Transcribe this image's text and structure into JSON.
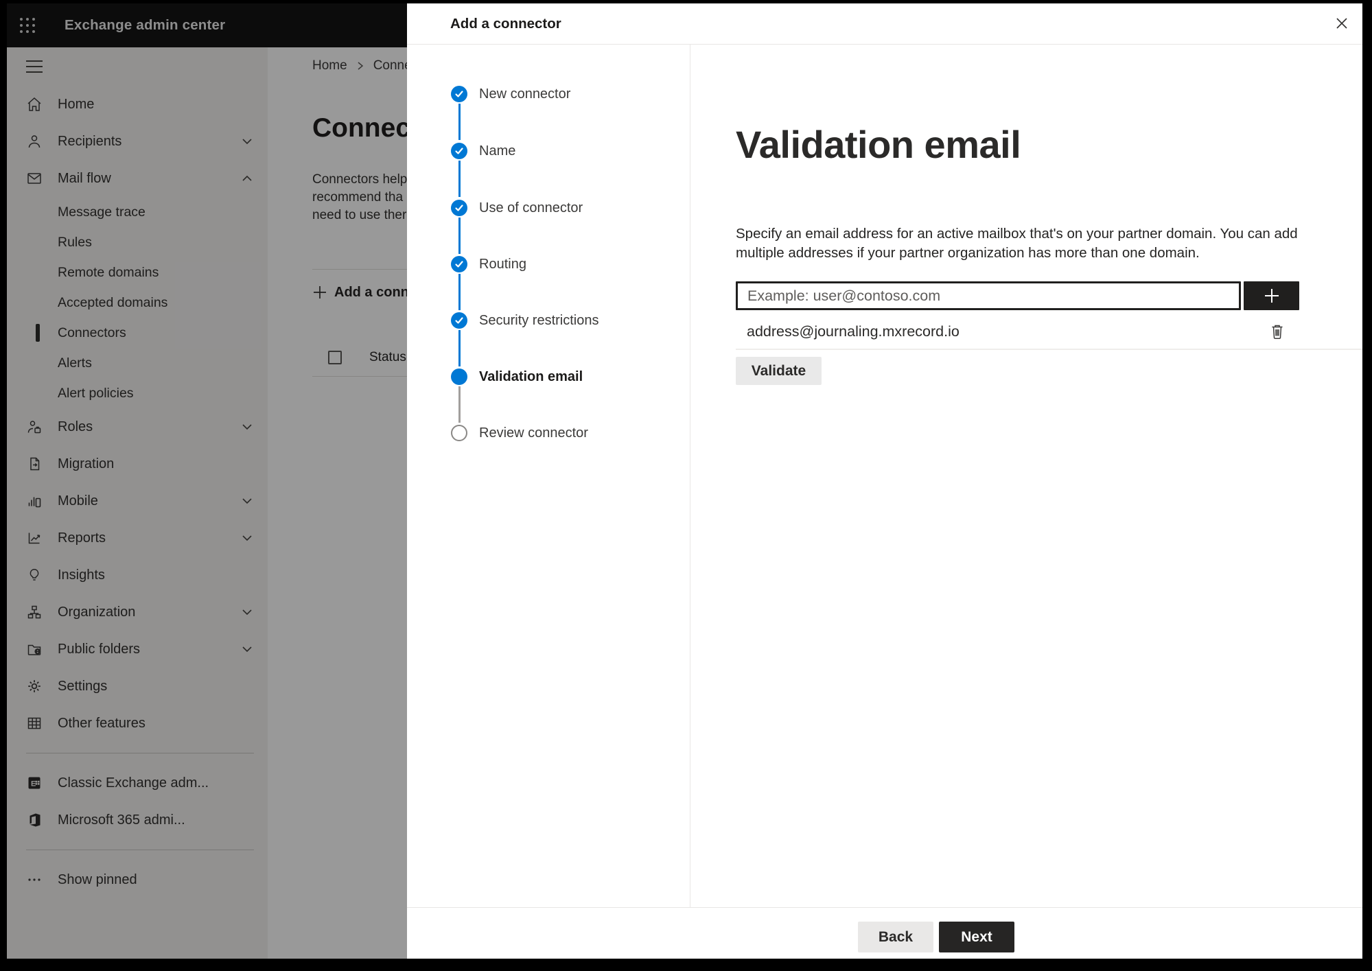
{
  "topbar": {
    "app_title": "Exchange admin center"
  },
  "sidebar": {
    "items": [
      {
        "label": "Home"
      },
      {
        "label": "Recipients"
      },
      {
        "label": "Mail flow"
      },
      {
        "label": "Message trace"
      },
      {
        "label": "Rules"
      },
      {
        "label": "Remote domains"
      },
      {
        "label": "Accepted domains"
      },
      {
        "label": "Connectors",
        "selected": true
      },
      {
        "label": "Alerts"
      },
      {
        "label": "Alert policies"
      },
      {
        "label": "Roles"
      },
      {
        "label": "Migration"
      },
      {
        "label": "Mobile"
      },
      {
        "label": "Reports"
      },
      {
        "label": "Insights"
      },
      {
        "label": "Organization"
      },
      {
        "label": "Public folders"
      },
      {
        "label": "Settings"
      },
      {
        "label": "Other features"
      },
      {
        "label": "Classic Exchange adm..."
      },
      {
        "label": "Microsoft 365 admi..."
      },
      {
        "label": "Show pinned"
      }
    ]
  },
  "background": {
    "breadcrumb_home": "Home",
    "breadcrumb_current": "Connectors",
    "page_title": "Connectors",
    "description_lines": [
      "Connectors help",
      "recommend tha",
      "need to use ther"
    ],
    "add_connector_button": "Add a connector",
    "status_column_header": "Status"
  },
  "dialog": {
    "title": "Add a connector",
    "steps": [
      {
        "label": "New connector",
        "state": "completed"
      },
      {
        "label": "Name",
        "state": "completed"
      },
      {
        "label": "Use of connector",
        "state": "completed"
      },
      {
        "label": "Routing",
        "state": "completed"
      },
      {
        "label": "Security restrictions",
        "state": "completed"
      },
      {
        "label": "Validation email",
        "state": "current"
      },
      {
        "label": "Review connector",
        "state": "upcoming"
      }
    ],
    "content": {
      "heading": "Validation email",
      "description_line1": "Specify an email address for an active mailbox that's on your partner domain. You can add",
      "description_line2": "multiple addresses if your partner organization has more than one domain.",
      "email_value": "",
      "email_placeholder": "Example: user@contoso.com",
      "addresses": [
        {
          "email": "address@journaling.mxrecord.io"
        }
      ],
      "validate_button": "Validate"
    },
    "footer": {
      "back_button": "Back",
      "next_button": "Next"
    }
  },
  "colors": {
    "accent_blue": "#0078d4",
    "topbar_bg": "#151515",
    "sidebar_bg": "#f3f2f1",
    "dark_button": "#262524",
    "text_dark": "#323130",
    "upcoming_gray": "#8a8886"
  }
}
